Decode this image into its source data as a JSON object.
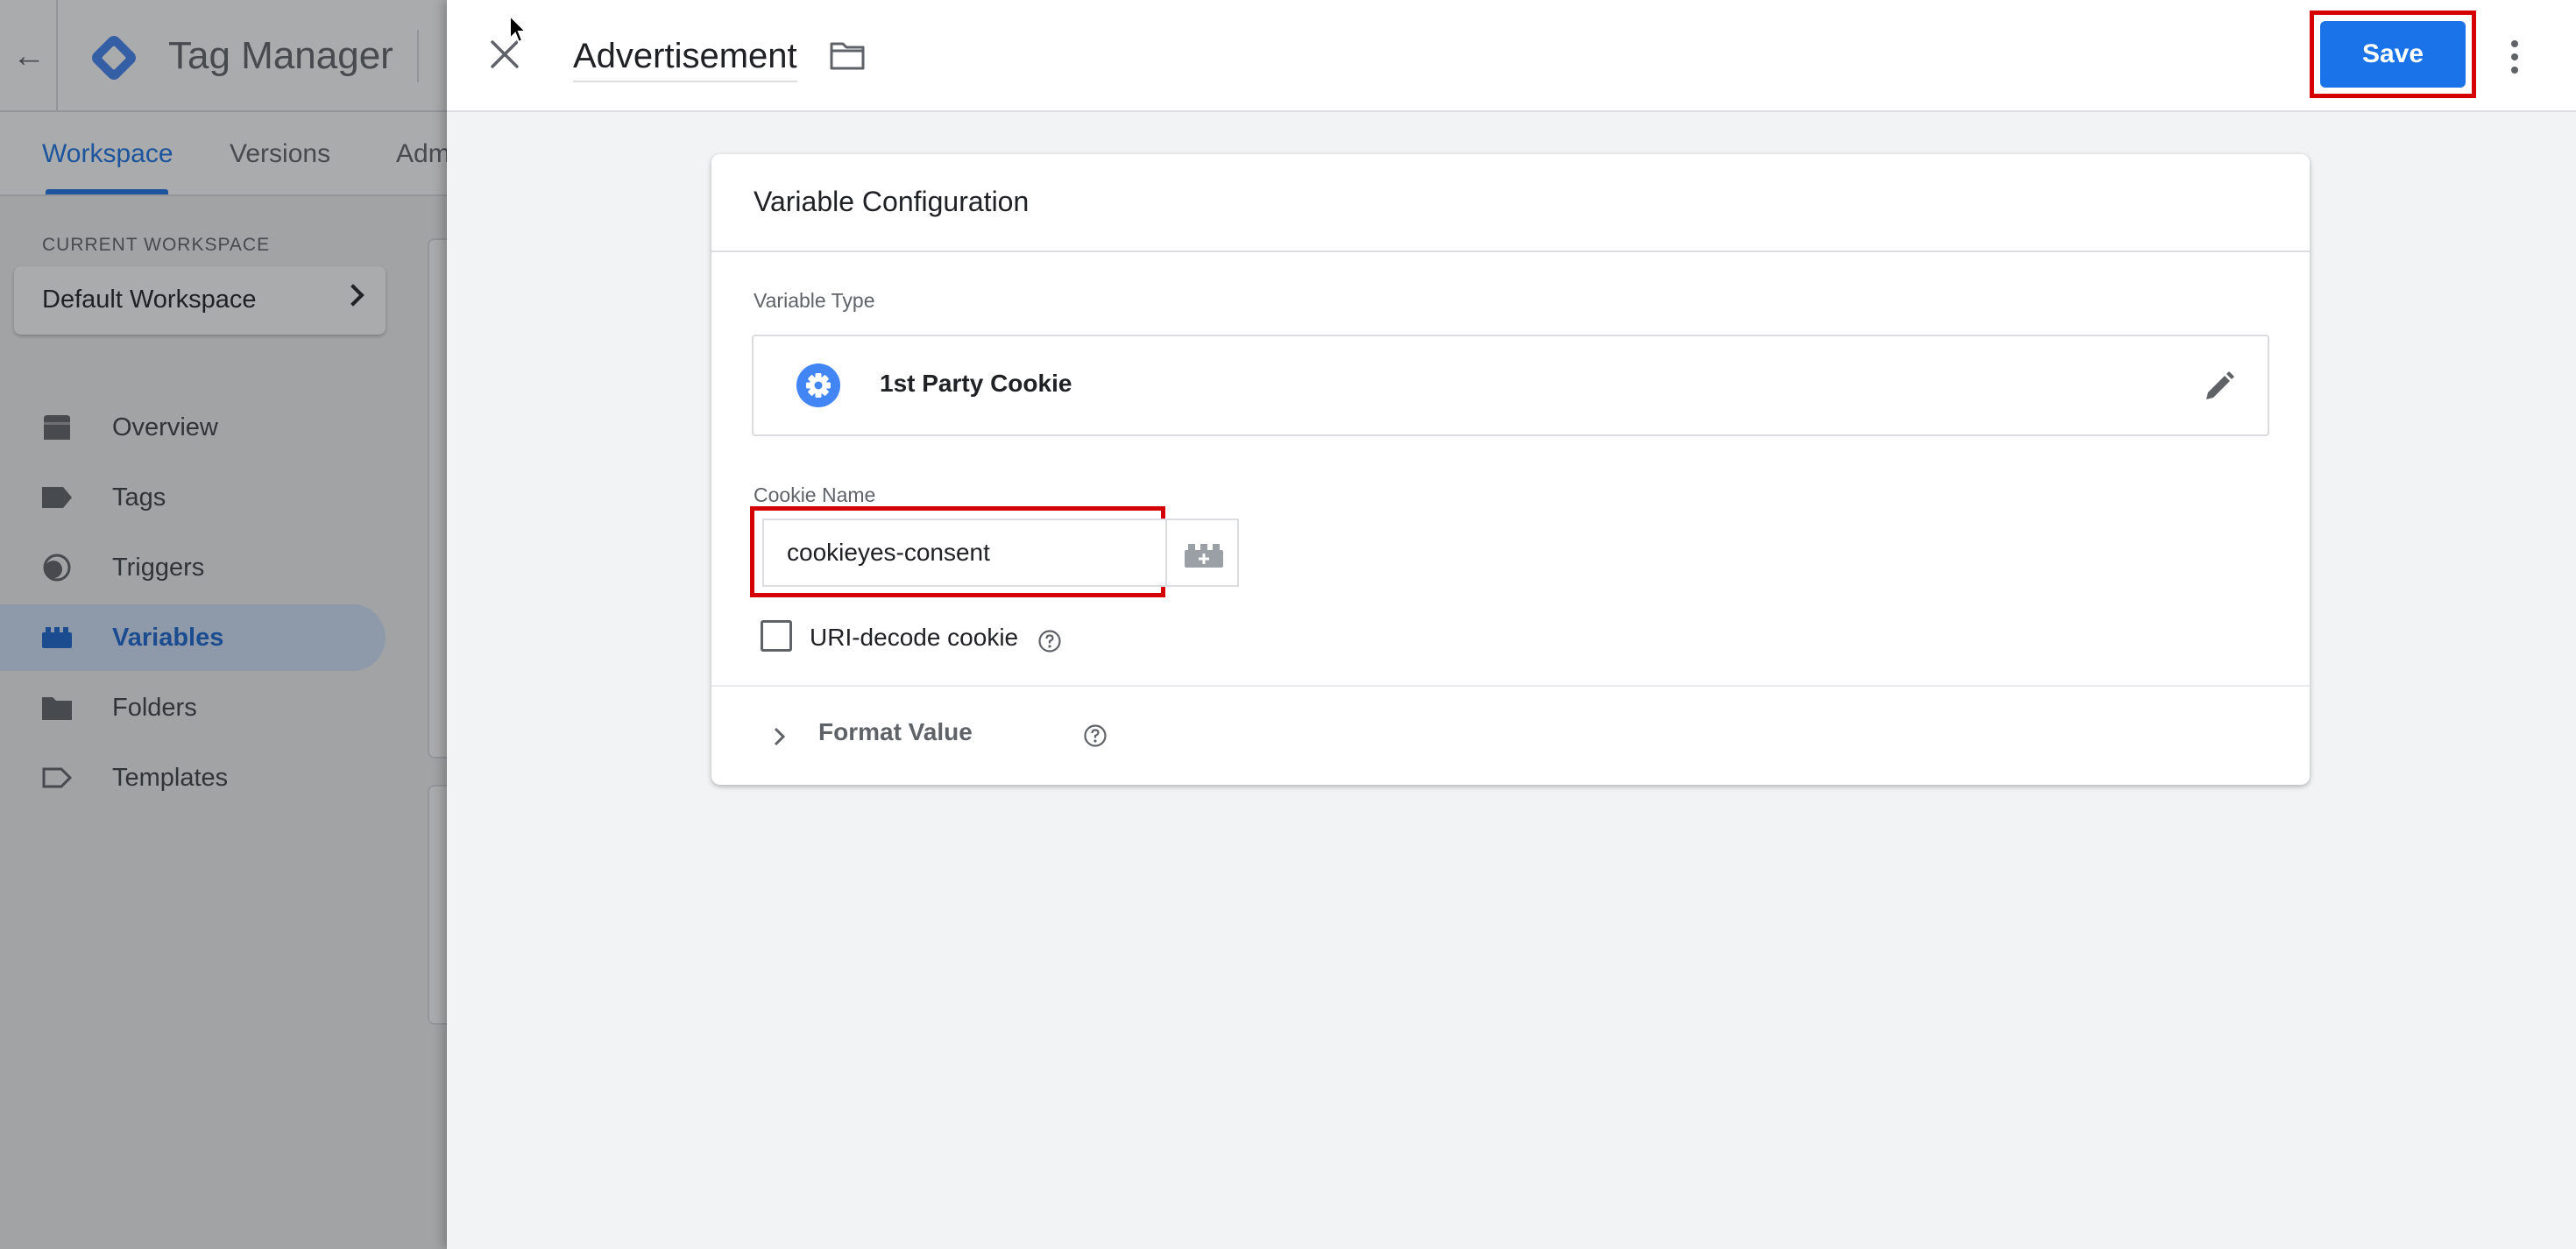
{
  "app": {
    "title": "Tag Manager",
    "nav_tabs": [
      {
        "label": "Workspace"
      },
      {
        "label": "Versions"
      },
      {
        "label": "Adm"
      }
    ],
    "workspace": {
      "section_label": "CURRENT WORKSPACE",
      "name": "Default Workspace"
    },
    "sidebar": {
      "items": [
        {
          "label": "Overview",
          "icon": "overview-icon"
        },
        {
          "label": "Tags",
          "icon": "tag-icon"
        },
        {
          "label": "Triggers",
          "icon": "trigger-icon"
        },
        {
          "label": "Variables",
          "icon": "variables-icon",
          "active": true
        },
        {
          "label": "Folders",
          "icon": "folder-icon"
        },
        {
          "label": "Templates",
          "icon": "template-icon"
        }
      ]
    }
  },
  "panel": {
    "title": "Advertisement",
    "save_label": "Save",
    "card": {
      "title": "Variable Configuration",
      "variable_type_label": "Variable Type",
      "variable_type_name": "1st Party Cookie",
      "cookie_name_label": "Cookie Name",
      "cookie_name_value": "cookieyes-consent",
      "uri_decode_label": "URI-decode cookie",
      "uri_decode_checked": false,
      "format_value_label": "Format Value"
    }
  },
  "colors": {
    "accent": "#1a73e8",
    "highlight": "#d50000",
    "active_nav_bg": "#d2e3fc"
  }
}
